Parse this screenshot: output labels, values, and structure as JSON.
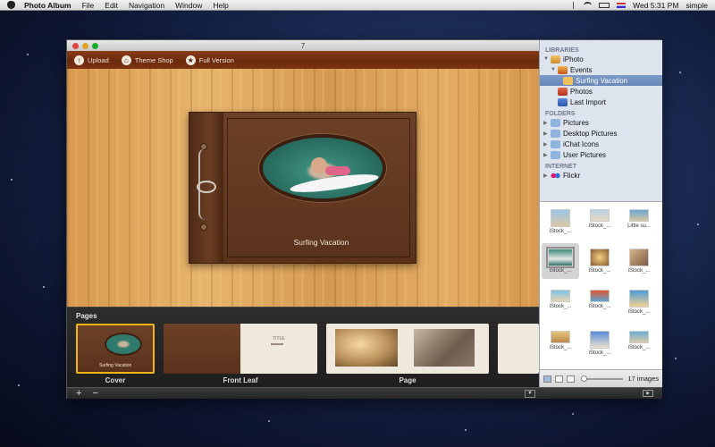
{
  "menubar": {
    "app_name": "Photo Album",
    "menus": [
      "File",
      "Edit",
      "Navigation",
      "Window",
      "Help"
    ],
    "clock": "Wed 5:31 PM",
    "user": "simple"
  },
  "window": {
    "title": "7"
  },
  "toolbar": {
    "upload": "Upload",
    "theme_shop": "Theme Shop",
    "full_version": "Full Version"
  },
  "album": {
    "title": "Surfing Vacation"
  },
  "pages": {
    "label": "Pages",
    "thumbs": [
      {
        "label": "Cover"
      },
      {
        "label": "Front Leaf"
      },
      {
        "label": "Page"
      }
    ],
    "cover_caption": "Surfing Vacation",
    "front_leaf_title": "TITLE"
  },
  "sidebar": {
    "libraries_header": "LIBRARIES",
    "iphoto": "iPhoto",
    "events": "Events",
    "surfing_vacation": "Surfing Vacation",
    "photos": "Photos",
    "last_import": "Last Import",
    "folders_header": "FOLDERS",
    "folders": [
      "Pictures",
      "Desktop Pictures",
      "iChat Icons",
      "User Pictures"
    ],
    "internet_header": "INTERNET",
    "flickr": "Flickr"
  },
  "grid": {
    "captions": [
      "iStock_...",
      "iStock_...",
      "Little su...",
      "iStock_...",
      "iStock_...",
      "iStock_...",
      "iStock_...",
      "iStock_...",
      "iStock_...",
      "iStock_...",
      "iStock_...",
      "iStock_..."
    ],
    "count": "17 images"
  },
  "colors": {
    "selection": "#6887b7",
    "cover_border": "#f2b419",
    "toolbar": "#6a2a0d"
  }
}
